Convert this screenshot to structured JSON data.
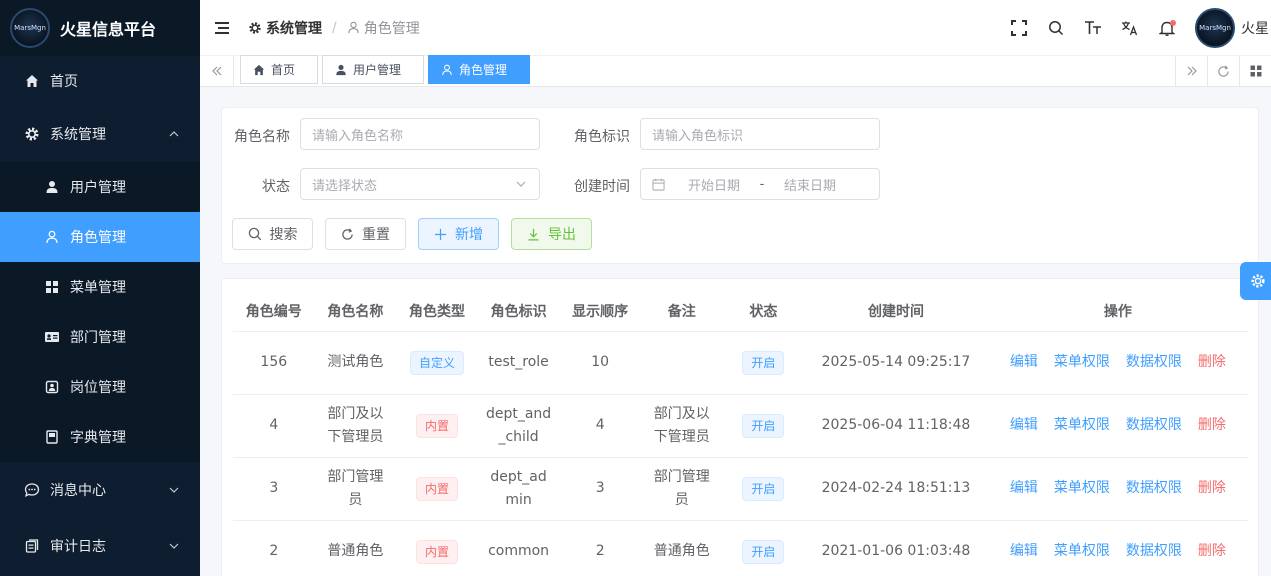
{
  "app": {
    "title": "火星信息平台",
    "logo_text": "MarsMgn"
  },
  "sidebar": {
    "items": [
      {
        "label": "首页",
        "icon": "home-icon"
      },
      {
        "label": "系统管理",
        "icon": "gear-icon",
        "expanded": true
      },
      {
        "label": "用户管理",
        "icon": "user-icon"
      },
      {
        "label": "角色管理",
        "icon": "user-outline-icon",
        "active": true
      },
      {
        "label": "菜单管理",
        "icon": "grid-icon"
      },
      {
        "label": "部门管理",
        "icon": "id-card-icon"
      },
      {
        "label": "岗位管理",
        "icon": "badge-icon"
      },
      {
        "label": "字典管理",
        "icon": "book-icon"
      },
      {
        "label": "消息中心",
        "icon": "chat-icon"
      },
      {
        "label": "审计日志",
        "icon": "log-icon"
      }
    ]
  },
  "header": {
    "breadcrumb": [
      "系统管理",
      "角色管理"
    ],
    "username": "火星",
    "avatar_text": "MarsMgn"
  },
  "tags": [
    {
      "label": "首页"
    },
    {
      "label": "用户管理"
    },
    {
      "label": "角色管理",
      "active": true
    }
  ],
  "search": {
    "role_name_label": "角色名称",
    "role_name_placeholder": "请输入角色名称",
    "role_key_label": "角色标识",
    "role_key_placeholder": "请输入角色标识",
    "status_label": "状态",
    "status_placeholder": "请选择状态",
    "created_label": "创建时间",
    "start_placeholder": "开始日期",
    "range_sep": "-",
    "end_placeholder": "结束日期",
    "btn_search": "搜索",
    "btn_reset": "重置",
    "btn_add": "新增",
    "btn_export": "导出"
  },
  "table": {
    "headers": [
      "角色编号",
      "角色名称",
      "角色类型",
      "角色标识",
      "显示顺序",
      "备注",
      "状态",
      "创建时间",
      "操作"
    ],
    "actions": [
      "编辑",
      "菜单权限",
      "数据权限",
      "删除"
    ],
    "rows": [
      {
        "id": "156",
        "name": "测试角色",
        "type": "自定义",
        "type_style": "info",
        "key": "test_role",
        "order": "10",
        "remark": "",
        "status": "开启",
        "created": "2025-05-14 09:25:17"
      },
      {
        "id": "4",
        "name": "部门及以下管理员",
        "type": "内置",
        "type_style": "danger",
        "key": "dept_and_child",
        "order": "4",
        "remark": "部门及以下管理员",
        "status": "开启",
        "created": "2025-06-04 11:18:48"
      },
      {
        "id": "3",
        "name": "部门管理员",
        "type": "内置",
        "type_style": "danger",
        "key": "dept_admin",
        "order": "3",
        "remark": "部门管理员",
        "status": "开启",
        "created": "2024-02-24 18:51:13"
      },
      {
        "id": "2",
        "name": "普通角色",
        "type": "内置",
        "type_style": "danger",
        "key": "common",
        "order": "2",
        "remark": "普通角色",
        "status": "开启",
        "created": "2021-01-06 01:03:48"
      }
    ]
  },
  "colors": {
    "sidebar_bg": "#0e1d2f",
    "accent": "#409eff",
    "danger": "#f56c6c",
    "success": "#67c23a"
  }
}
